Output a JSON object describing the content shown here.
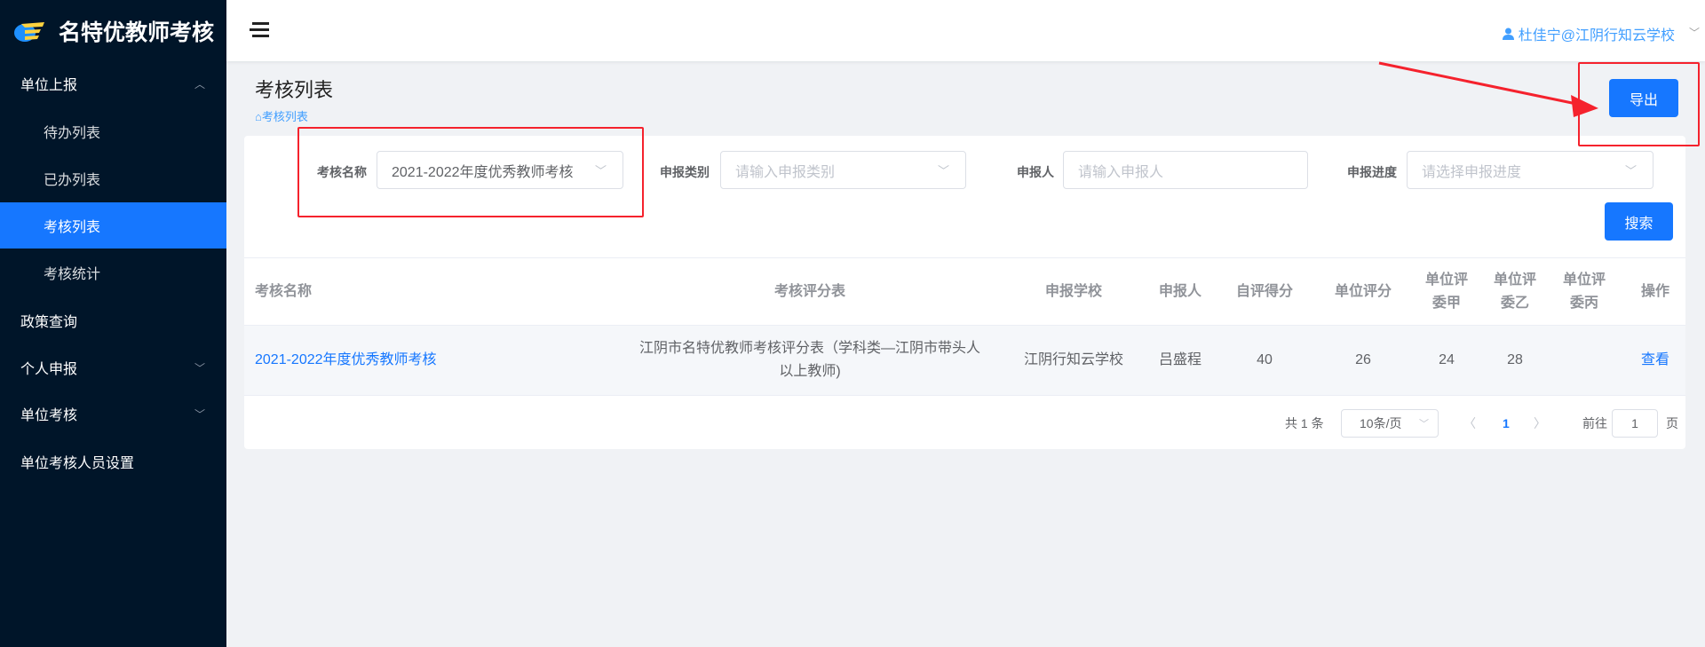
{
  "app": {
    "title": "名特优教师考核"
  },
  "sidebar": {
    "items": [
      {
        "label": "单位上报",
        "expanded": true
      },
      {
        "label": "待办列表"
      },
      {
        "label": "已办列表"
      },
      {
        "label": "考核列表",
        "active": true
      },
      {
        "label": "考核统计"
      },
      {
        "label": "政策查询"
      },
      {
        "label": "个人申报"
      },
      {
        "label": "单位考核"
      },
      {
        "label": "单位考核人员设置"
      }
    ]
  },
  "header": {
    "user": "杜佳宁@江阴行知云学校"
  },
  "page": {
    "title": "考核列表",
    "breadcrumb": "考核列表",
    "export_label": "导出"
  },
  "filters": {
    "name_label": "考核名称",
    "name_value": "2021-2022年度优秀教师考核",
    "type_label": "申报类别",
    "type_placeholder": "请输入申报类别",
    "applicant_label": "申报人",
    "applicant_placeholder": "请输入申报人",
    "progress_label": "申报进度",
    "progress_placeholder": "请选择申报进度",
    "search_label": "搜索"
  },
  "table": {
    "headers": [
      "考核名称",
      "考核评分表",
      "申报学校",
      "申报人",
      "自评得分",
      "单位评分",
      "单位评委甲",
      "单位评委乙",
      "单位评委丙",
      "操作"
    ],
    "rows": [
      {
        "name": "2021-2022年度优秀教师考核",
        "form": "江阴市名特优教师考核评分表（学科类—江阴市带头人以上教师)",
        "school": "江阴行知云学校",
        "applicant": "吕盛程",
        "self": "40",
        "unit": "26",
        "a": "24",
        "b": "28",
        "c": "",
        "action": "查看"
      }
    ]
  },
  "pagination": {
    "total": "共 1 条",
    "page_size": "10条/页",
    "current": "1",
    "goto_label": "前往",
    "goto_value": "1",
    "page_suffix": "页"
  },
  "colors": {
    "sidebar": "#001529",
    "primary": "#1677ff",
    "annotation": "#f5222d"
  }
}
